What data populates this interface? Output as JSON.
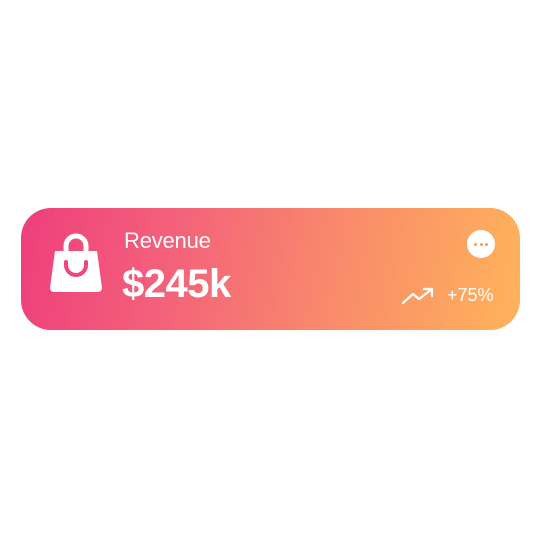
{
  "card": {
    "title": "Revenue",
    "value": "$245k",
    "trend": {
      "value": "+75%",
      "direction": "up",
      "icon": "trending-up-icon"
    },
    "icon": "shopping-bag-icon",
    "menu_icon": "more-horizontal-icon",
    "gradient": {
      "start": "#ee3e7c",
      "end": "#ffb35a"
    }
  }
}
